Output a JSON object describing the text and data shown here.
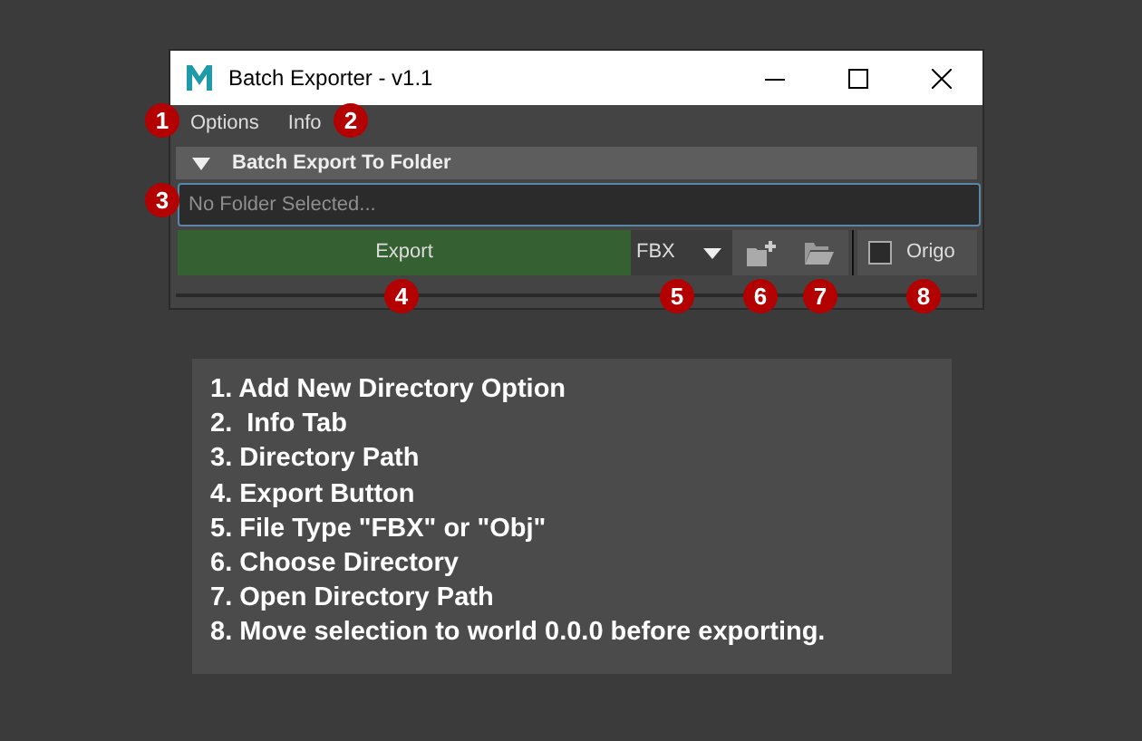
{
  "window": {
    "title": "Batch Exporter - v1.1"
  },
  "menu": [
    {
      "label": "Options"
    },
    {
      "label": "Info"
    }
  ],
  "section": {
    "title": "Batch Export To Folder",
    "expanded": true
  },
  "path_field": {
    "placeholder": "No Folder Selected..."
  },
  "export_button": {
    "label": "Export"
  },
  "file_type": {
    "value": "FBX"
  },
  "origo": {
    "label": "Origo",
    "checked": false
  },
  "callouts": [
    "1",
    "2",
    "3",
    "4",
    "5",
    "6",
    "7",
    "8"
  ],
  "legend": [
    "1. Add New Directory Option",
    "2.  Info Tab",
    "3. Directory Path",
    "4. Export Button",
    "5. File Type \"FBX\" or \"Obj\"",
    "6. Choose Directory",
    "7. Open Directory Path",
    "8. Move selection to world 0.0.0 before exporting."
  ]
}
